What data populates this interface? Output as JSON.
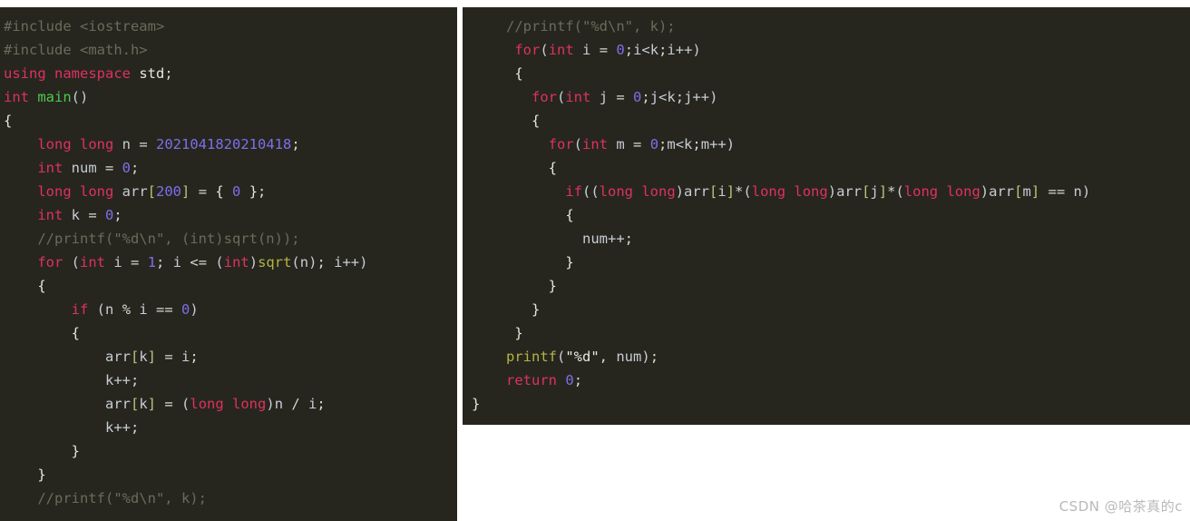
{
  "page": {
    "background": "#ffffff",
    "editor_background": "#26261f",
    "default_text_color": "#d4d4cc"
  },
  "theme_colors": {
    "preprocessor": "#6b6b5a",
    "comment": "#6b6b5a",
    "keyword": "#e0315c",
    "function": "#b5b344",
    "function_main": "#4ec94e",
    "number": "#7d6fe8",
    "identifier": "#c8ccd4",
    "string": "#e8e8e0",
    "bracket": "#c2c07a",
    "brace": "#e6e6da",
    "paren": "#c9cdd6"
  },
  "left_panel": {
    "name": "code-pane-left",
    "language": "cpp",
    "lines": [
      [
        {
          "t": "#include <iostream>",
          "c": "tok-pre"
        }
      ],
      [
        {
          "t": "#include <math.h>",
          "c": "tok-pre"
        }
      ],
      [
        {
          "t": "using namespace",
          "c": "tok-kw"
        },
        {
          "t": " ",
          "c": "tok-punc"
        },
        {
          "t": "std",
          "c": "tok-str"
        },
        {
          "t": ";",
          "c": "tok-punc"
        }
      ],
      [
        {
          "t": "int",
          "c": "tok-kw"
        },
        {
          "t": " ",
          "c": "tok-punc"
        },
        {
          "t": "main",
          "c": "tok-fn-green"
        },
        {
          "t": "()",
          "c": "tok-paren"
        }
      ],
      [
        {
          "t": "{",
          "c": "tok-brace"
        }
      ],
      [
        {
          "t": "    ",
          "c": "tok-punc"
        },
        {
          "t": "long long",
          "c": "tok-kw"
        },
        {
          "t": " ",
          "c": "tok-punc"
        },
        {
          "t": "n",
          "c": "tok-id"
        },
        {
          "t": " = ",
          "c": "tok-op"
        },
        {
          "t": "2021041820210418",
          "c": "tok-num"
        },
        {
          "t": ";",
          "c": "tok-punc"
        }
      ],
      [
        {
          "t": "    ",
          "c": "tok-punc"
        },
        {
          "t": "int",
          "c": "tok-kw"
        },
        {
          "t": " ",
          "c": "tok-punc"
        },
        {
          "t": "num",
          "c": "tok-id"
        },
        {
          "t": " = ",
          "c": "tok-op"
        },
        {
          "t": "0",
          "c": "tok-num"
        },
        {
          "t": ";",
          "c": "tok-punc"
        }
      ],
      [
        {
          "t": "    ",
          "c": "tok-punc"
        },
        {
          "t": "long long",
          "c": "tok-kw"
        },
        {
          "t": " ",
          "c": "tok-punc"
        },
        {
          "t": "arr",
          "c": "tok-id"
        },
        {
          "t": "[",
          "c": "tok-brack"
        },
        {
          "t": "200",
          "c": "tok-num"
        },
        {
          "t": "]",
          "c": "tok-brack"
        },
        {
          "t": " = ",
          "c": "tok-op"
        },
        {
          "t": "{ ",
          "c": "tok-brace"
        },
        {
          "t": "0",
          "c": "tok-num"
        },
        {
          "t": " }",
          "c": "tok-brace"
        },
        {
          "t": ";",
          "c": "tok-punc"
        }
      ],
      [
        {
          "t": "    ",
          "c": "tok-punc"
        },
        {
          "t": "int",
          "c": "tok-kw"
        },
        {
          "t": " ",
          "c": "tok-punc"
        },
        {
          "t": "k",
          "c": "tok-id"
        },
        {
          "t": " = ",
          "c": "tok-op"
        },
        {
          "t": "0",
          "c": "tok-num"
        },
        {
          "t": ";",
          "c": "tok-punc"
        }
      ],
      [
        {
          "t": "    //printf(\"%d\\n\", (int)sqrt(n));",
          "c": "tok-comment"
        }
      ],
      [
        {
          "t": "    ",
          "c": "tok-punc"
        },
        {
          "t": "for",
          "c": "tok-kw"
        },
        {
          "t": " ",
          "c": "tok-punc"
        },
        {
          "t": "(",
          "c": "tok-paren"
        },
        {
          "t": "int",
          "c": "tok-kw"
        },
        {
          "t": " ",
          "c": "tok-punc"
        },
        {
          "t": "i",
          "c": "tok-id"
        },
        {
          "t": " = ",
          "c": "tok-op"
        },
        {
          "t": "1",
          "c": "tok-num"
        },
        {
          "t": "; ",
          "c": "tok-punc"
        },
        {
          "t": "i",
          "c": "tok-id"
        },
        {
          "t": " <= ",
          "c": "tok-op"
        },
        {
          "t": "(",
          "c": "tok-paren"
        },
        {
          "t": "int",
          "c": "tok-kw"
        },
        {
          "t": ")",
          "c": "tok-paren"
        },
        {
          "t": "sqrt",
          "c": "tok-fn"
        },
        {
          "t": "(",
          "c": "tok-paren"
        },
        {
          "t": "n",
          "c": "tok-id"
        },
        {
          "t": ")",
          "c": "tok-paren"
        },
        {
          "t": "; ",
          "c": "tok-punc"
        },
        {
          "t": "i++",
          "c": "tok-id"
        },
        {
          "t": ")",
          "c": "tok-paren"
        }
      ],
      [
        {
          "t": "    ",
          "c": "tok-punc"
        },
        {
          "t": "{",
          "c": "tok-brace"
        }
      ],
      [
        {
          "t": "        ",
          "c": "tok-punc"
        },
        {
          "t": "if",
          "c": "tok-kw"
        },
        {
          "t": " ",
          "c": "tok-punc"
        },
        {
          "t": "(",
          "c": "tok-paren"
        },
        {
          "t": "n",
          "c": "tok-id"
        },
        {
          "t": " % ",
          "c": "tok-op"
        },
        {
          "t": "i",
          "c": "tok-id"
        },
        {
          "t": " == ",
          "c": "tok-op"
        },
        {
          "t": "0",
          "c": "tok-num"
        },
        {
          "t": ")",
          "c": "tok-paren"
        }
      ],
      [
        {
          "t": "        ",
          "c": "tok-punc"
        },
        {
          "t": "{",
          "c": "tok-brace"
        }
      ],
      [
        {
          "t": "            ",
          "c": "tok-punc"
        },
        {
          "t": "arr",
          "c": "tok-id"
        },
        {
          "t": "[",
          "c": "tok-brack"
        },
        {
          "t": "k",
          "c": "tok-id"
        },
        {
          "t": "]",
          "c": "tok-brack"
        },
        {
          "t": " = ",
          "c": "tok-op"
        },
        {
          "t": "i",
          "c": "tok-id"
        },
        {
          "t": ";",
          "c": "tok-punc"
        }
      ],
      [
        {
          "t": "            ",
          "c": "tok-punc"
        },
        {
          "t": "k++",
          "c": "tok-id"
        },
        {
          "t": ";",
          "c": "tok-punc"
        }
      ],
      [
        {
          "t": "            ",
          "c": "tok-punc"
        },
        {
          "t": "arr",
          "c": "tok-id"
        },
        {
          "t": "[",
          "c": "tok-brack"
        },
        {
          "t": "k",
          "c": "tok-id"
        },
        {
          "t": "]",
          "c": "tok-brack"
        },
        {
          "t": " = ",
          "c": "tok-op"
        },
        {
          "t": "(",
          "c": "tok-paren"
        },
        {
          "t": "long long",
          "c": "tok-kw"
        },
        {
          "t": ")",
          "c": "tok-paren"
        },
        {
          "t": "n",
          "c": "tok-id"
        },
        {
          "t": " / ",
          "c": "tok-op"
        },
        {
          "t": "i",
          "c": "tok-id"
        },
        {
          "t": ";",
          "c": "tok-punc"
        }
      ],
      [
        {
          "t": "            ",
          "c": "tok-punc"
        },
        {
          "t": "k++",
          "c": "tok-id"
        },
        {
          "t": ";",
          "c": "tok-punc"
        }
      ],
      [
        {
          "t": "        ",
          "c": "tok-punc"
        },
        {
          "t": "}",
          "c": "tok-brace"
        }
      ],
      [
        {
          "t": "    ",
          "c": "tok-punc"
        },
        {
          "t": "}",
          "c": "tok-brace"
        }
      ],
      [
        {
          "t": "    //printf(\"%d\\n\", k);",
          "c": "tok-comment"
        }
      ]
    ]
  },
  "right_panel": {
    "name": "code-pane-right",
    "language": "cpp",
    "lines": [
      [
        {
          "t": "//printf(\"%d\\n\", k);",
          "c": "tok-comment"
        }
      ],
      [
        {
          "t": " ",
          "c": "tok-punc"
        },
        {
          "t": "for",
          "c": "tok-kw"
        },
        {
          "t": "(",
          "c": "tok-paren"
        },
        {
          "t": "int",
          "c": "tok-kw"
        },
        {
          "t": " ",
          "c": "tok-punc"
        },
        {
          "t": "i",
          "c": "tok-id"
        },
        {
          "t": " = ",
          "c": "tok-op"
        },
        {
          "t": "0",
          "c": "tok-num"
        },
        {
          "t": ";",
          "c": "tok-punc"
        },
        {
          "t": "i<k",
          "c": "tok-id"
        },
        {
          "t": ";",
          "c": "tok-punc"
        },
        {
          "t": "i++",
          "c": "tok-id"
        },
        {
          "t": ")",
          "c": "tok-paren"
        }
      ],
      [
        {
          "t": " ",
          "c": "tok-punc"
        },
        {
          "t": "{",
          "c": "tok-brace"
        }
      ],
      [
        {
          "t": "   ",
          "c": "tok-punc"
        },
        {
          "t": "for",
          "c": "tok-kw"
        },
        {
          "t": "(",
          "c": "tok-paren"
        },
        {
          "t": "int",
          "c": "tok-kw"
        },
        {
          "t": " ",
          "c": "tok-punc"
        },
        {
          "t": "j",
          "c": "tok-id"
        },
        {
          "t": " = ",
          "c": "tok-op"
        },
        {
          "t": "0",
          "c": "tok-num"
        },
        {
          "t": ";",
          "c": "tok-punc"
        },
        {
          "t": "j<k",
          "c": "tok-id"
        },
        {
          "t": ";",
          "c": "tok-punc"
        },
        {
          "t": "j++",
          "c": "tok-id"
        },
        {
          "t": ")",
          "c": "tok-paren"
        }
      ],
      [
        {
          "t": "   ",
          "c": "tok-punc"
        },
        {
          "t": "{",
          "c": "tok-brace"
        }
      ],
      [
        {
          "t": "     ",
          "c": "tok-punc"
        },
        {
          "t": "for",
          "c": "tok-kw"
        },
        {
          "t": "(",
          "c": "tok-paren"
        },
        {
          "t": "int",
          "c": "tok-kw"
        },
        {
          "t": " ",
          "c": "tok-punc"
        },
        {
          "t": "m",
          "c": "tok-id"
        },
        {
          "t": " = ",
          "c": "tok-op"
        },
        {
          "t": "0",
          "c": "tok-num"
        },
        {
          "t": ";",
          "c": "tok-punc"
        },
        {
          "t": "m<k",
          "c": "tok-id"
        },
        {
          "t": ";",
          "c": "tok-punc"
        },
        {
          "t": "m++",
          "c": "tok-id"
        },
        {
          "t": ")",
          "c": "tok-paren"
        }
      ],
      [
        {
          "t": "     ",
          "c": "tok-punc"
        },
        {
          "t": "{",
          "c": "tok-brace"
        }
      ],
      [
        {
          "t": "       ",
          "c": "tok-punc"
        },
        {
          "t": "if",
          "c": "tok-kw"
        },
        {
          "t": "((",
          "c": "tok-paren"
        },
        {
          "t": "long long",
          "c": "tok-kw"
        },
        {
          "t": ")",
          "c": "tok-paren"
        },
        {
          "t": "arr",
          "c": "tok-id"
        },
        {
          "t": "[",
          "c": "tok-brack"
        },
        {
          "t": "i",
          "c": "tok-id"
        },
        {
          "t": "]",
          "c": "tok-brack"
        },
        {
          "t": "*",
          "c": "tok-op"
        },
        {
          "t": "(",
          "c": "tok-paren"
        },
        {
          "t": "long long",
          "c": "tok-kw"
        },
        {
          "t": ")",
          "c": "tok-paren"
        },
        {
          "t": "arr",
          "c": "tok-id"
        },
        {
          "t": "[",
          "c": "tok-brack"
        },
        {
          "t": "j",
          "c": "tok-id"
        },
        {
          "t": "]",
          "c": "tok-brack"
        },
        {
          "t": "*",
          "c": "tok-op"
        },
        {
          "t": "(",
          "c": "tok-paren"
        },
        {
          "t": "long long",
          "c": "tok-kw"
        },
        {
          "t": ")",
          "c": "tok-paren"
        },
        {
          "t": "arr",
          "c": "tok-id"
        },
        {
          "t": "[",
          "c": "tok-brack"
        },
        {
          "t": "m",
          "c": "tok-id"
        },
        {
          "t": "]",
          "c": "tok-brack"
        },
        {
          "t": " == ",
          "c": "tok-op"
        },
        {
          "t": "n",
          "c": "tok-id"
        },
        {
          "t": ")",
          "c": "tok-paren"
        }
      ],
      [
        {
          "t": "       ",
          "c": "tok-punc"
        },
        {
          "t": "{",
          "c": "tok-brace"
        }
      ],
      [
        {
          "t": "         ",
          "c": "tok-punc"
        },
        {
          "t": "num++",
          "c": "tok-id"
        },
        {
          "t": ";",
          "c": "tok-punc"
        }
      ],
      [
        {
          "t": "       ",
          "c": "tok-punc"
        },
        {
          "t": "}",
          "c": "tok-brace"
        }
      ],
      [
        {
          "t": "     ",
          "c": "tok-punc"
        },
        {
          "t": "}",
          "c": "tok-brace"
        }
      ],
      [
        {
          "t": "   ",
          "c": "tok-punc"
        },
        {
          "t": "}",
          "c": "tok-brace"
        }
      ],
      [
        {
          "t": " ",
          "c": "tok-punc"
        },
        {
          "t": "}",
          "c": "tok-brace"
        }
      ],
      [
        {
          "t": "printf",
          "c": "tok-fn"
        },
        {
          "t": "(",
          "c": "tok-paren"
        },
        {
          "t": "\"%d\"",
          "c": "tok-str"
        },
        {
          "t": ", ",
          "c": "tok-punc"
        },
        {
          "t": "num",
          "c": "tok-id"
        },
        {
          "t": ")",
          "c": "tok-paren"
        },
        {
          "t": ";",
          "c": "tok-punc"
        }
      ],
      [
        {
          "t": "return",
          "c": "tok-kw"
        },
        {
          "t": " ",
          "c": "tok-punc"
        },
        {
          "t": "0",
          "c": "tok-num"
        },
        {
          "t": ";",
          "c": "tok-punc"
        }
      ]
    ],
    "closing_brace_line": [
      {
        "t": "}",
        "c": "tok-brace"
      }
    ]
  },
  "watermark": {
    "text": "CSDN @哈茶真的c"
  }
}
